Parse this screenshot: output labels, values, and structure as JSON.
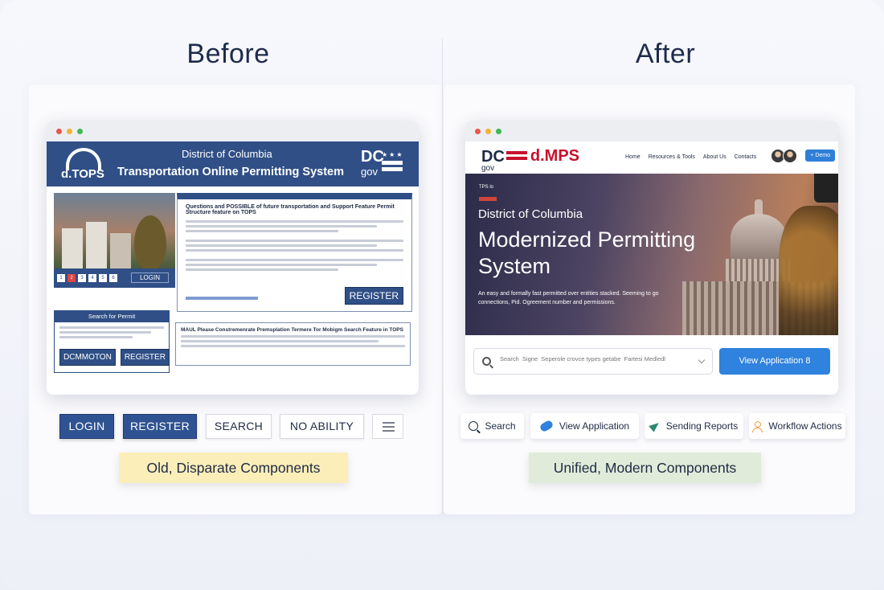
{
  "headings": {
    "before": "Before",
    "after": "After"
  },
  "old_site": {
    "logo_text": "d.TOPS",
    "title_line1": "District of Columbia",
    "title_line2": "Transportation Online Permitting System",
    "dc_logo": {
      "dc": "DC",
      "gov": "gov"
    },
    "pager": [
      "1",
      "2",
      "3",
      "4",
      "5",
      "6"
    ],
    "photo_login": "LOGIN",
    "notice_heading": "Questions and POSSIBLE of future transportation and Support Feature Permit Structure feature on TOPS",
    "notice_register": "REGISTER",
    "search_box_title": "Search for Permit",
    "search_box_buttons": [
      "DCMMOTON",
      "REGISTER"
    ],
    "feature_heading": "MAUL Please Constremenrate Premsplation Termere Tor Mobigm Search Feature in TOPS"
  },
  "new_site": {
    "logo": {
      "dc": "DC",
      "gov": "gov",
      "name": "d.MPS"
    },
    "menu": [
      "Home",
      "Resources & Tools",
      "About Us",
      "Contacts"
    ],
    "demo_button": "+ Demo",
    "hero": {
      "tag": "TPS lo",
      "subtitle": "District of Columbia",
      "title": "Modernized Permitting System",
      "description": "An easy and formally fast permitted over entities stacked. Seeming to go connections, Pid. Ogreement number and permissions."
    },
    "search_placeholder": "Search  Signe  Seperole crovce types getabe  Fartesi Medledl",
    "view_application": "View Application  8"
  },
  "old_components": [
    "LOGIN",
    "REGISTER",
    "SEARCH",
    "NO ABILITY"
  ],
  "new_components": [
    {
      "icon": "search-icon",
      "label": "Search"
    },
    {
      "icon": "pill-icon",
      "label": "View Application"
    },
    {
      "icon": "paper-plane-icon",
      "label": "Sending Reports"
    },
    {
      "icon": "person-icon",
      "label": "Workflow Actions"
    }
  ],
  "captions": {
    "old": "Old, Disparate Components",
    "new": "Unified, Modern Components"
  },
  "colors": {
    "old_blue": "#2f4f86",
    "new_blue": "#2f82dd",
    "dc_red": "#c8102e",
    "note_yellow": "#fbeeb9",
    "note_green": "#e0ecd9"
  }
}
